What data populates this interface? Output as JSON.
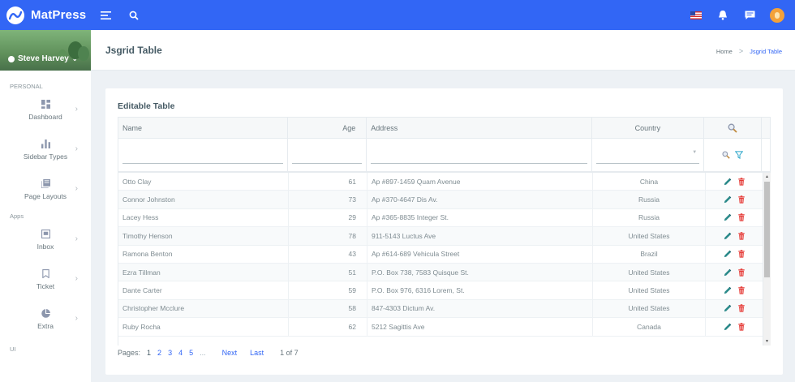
{
  "app": {
    "name": "MatPress"
  },
  "colors": {
    "primary": "#3266f5",
    "edit": "#2b8a8a",
    "delete": "#e53935"
  },
  "user": {
    "name": "Steve Harvey"
  },
  "sidebar": {
    "sections": [
      {
        "label": "PERSONAL",
        "items": [
          {
            "label": "Dashboard",
            "icon": "dashboard-icon"
          },
          {
            "label": "Sidebar Types",
            "icon": "bar-chart-icon"
          },
          {
            "label": "Page Layouts",
            "icon": "layers-icon"
          }
        ]
      },
      {
        "label": "Apps",
        "items": [
          {
            "label": "Inbox",
            "icon": "inbox-icon"
          },
          {
            "label": "Ticket",
            "icon": "bookmark-icon"
          },
          {
            "label": "Extra",
            "icon": "pie-chart-icon"
          }
        ]
      },
      {
        "label": "UI",
        "items": []
      }
    ]
  },
  "page": {
    "title": "Jsgrid Table",
    "breadcrumb": {
      "home": "Home",
      "sep": ">",
      "current": "Jsgrid Table"
    }
  },
  "card": {
    "title": "Editable Table"
  },
  "table": {
    "headers": {
      "name": "Name",
      "age": "Age",
      "address": "Address",
      "country": "Country"
    },
    "rows": [
      {
        "name": "Otto Clay",
        "age": "61",
        "address": "Ap #897-1459 Quam Avenue",
        "country": "China"
      },
      {
        "name": "Connor Johnston",
        "age": "73",
        "address": "Ap #370-4647 Dis Av.",
        "country": "Russia"
      },
      {
        "name": "Lacey Hess",
        "age": "29",
        "address": "Ap #365-8835 Integer St.",
        "country": "Russia"
      },
      {
        "name": "Timothy Henson",
        "age": "78",
        "address": "911-5143 Luctus Ave",
        "country": "United States"
      },
      {
        "name": "Ramona Benton",
        "age": "43",
        "address": "Ap #614-689 Vehicula Street",
        "country": "Brazil"
      },
      {
        "name": "Ezra Tillman",
        "age": "51",
        "address": "P.O. Box 738, 7583 Quisque St.",
        "country": "United States"
      },
      {
        "name": "Dante Carter",
        "age": "59",
        "address": "P.O. Box 976, 6316 Lorem, St.",
        "country": "United States"
      },
      {
        "name": "Christopher Mcclure",
        "age": "58",
        "address": "847-4303 Dictum Av.",
        "country": "United States"
      },
      {
        "name": "Ruby Rocha",
        "age": "62",
        "address": "5212 Sagittis Ave",
        "country": "Canada"
      }
    ]
  },
  "pager": {
    "label": "Pages:",
    "pages": [
      "1",
      "2",
      "3",
      "4",
      "5"
    ],
    "current": "1",
    "ellipsis": "...",
    "next": "Next",
    "last": "Last",
    "info": "1 of 7"
  }
}
